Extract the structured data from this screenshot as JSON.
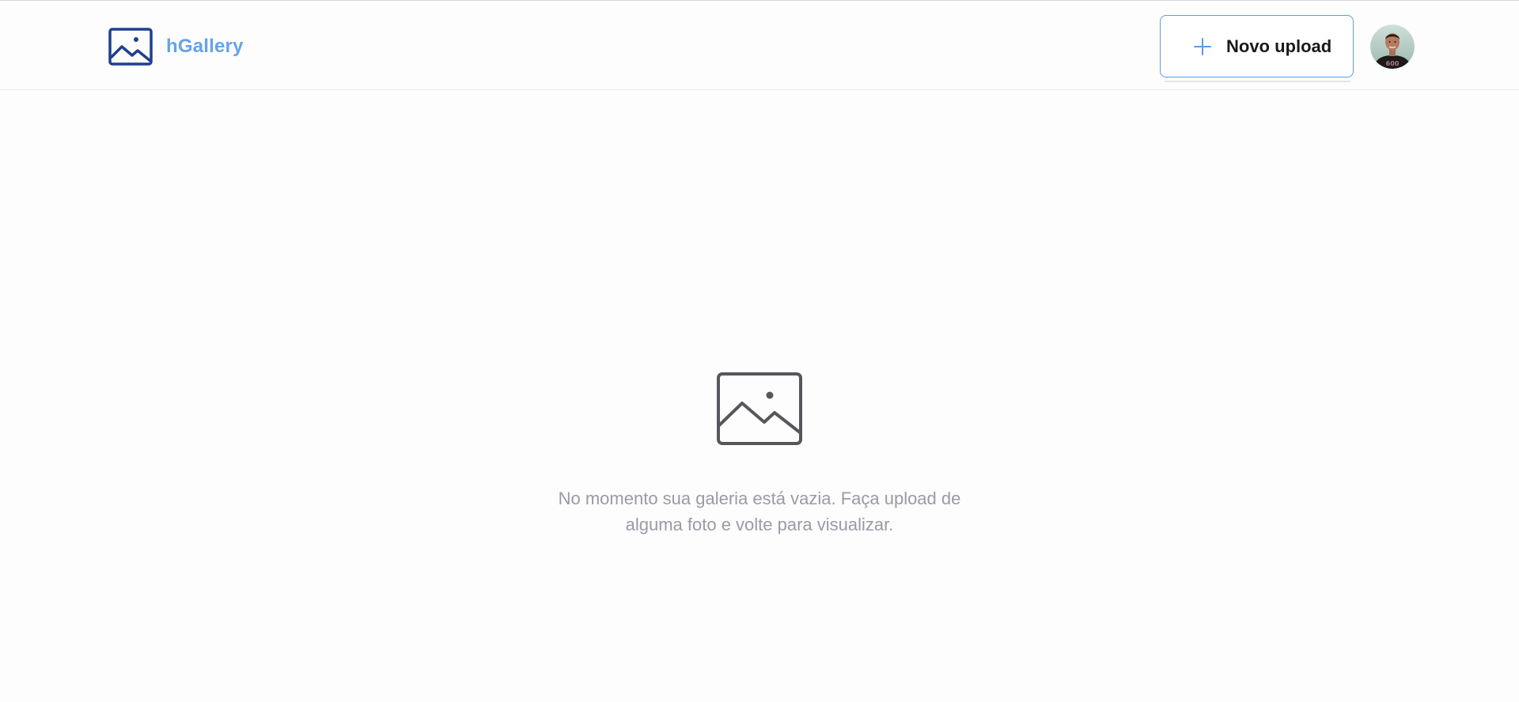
{
  "header": {
    "brand_name": "hGallery",
    "brand_icon": "image-icon",
    "brand_color": "#64a3ee",
    "upload_button": {
      "label": "Novo upload",
      "icon": "plus-icon",
      "border_color": "#5b9be8"
    },
    "avatar": {
      "icon": "user-avatar"
    }
  },
  "empty_state": {
    "icon": "image-placeholder-icon",
    "message": "No momento sua galeria está vazia. Faça upload de alguma foto e volte para visualizar."
  }
}
